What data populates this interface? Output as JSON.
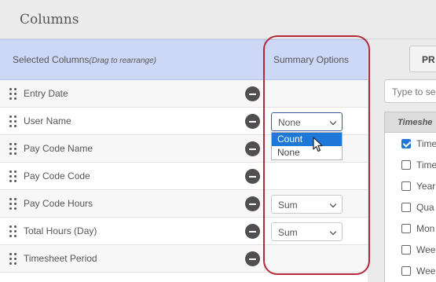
{
  "window": {
    "title": "Columns"
  },
  "header": {
    "selected_label": "Selected Columns",
    "selected_hint": "(Drag to rearrange)",
    "summary_label": "Summary Options"
  },
  "rows": [
    {
      "label": "Entry Date",
      "summary": null
    },
    {
      "label": "User Name",
      "summary": "None"
    },
    {
      "label": "Pay Code Name",
      "summary": null
    },
    {
      "label": "Pay Code Code",
      "summary": null
    },
    {
      "label": "Pay Code Hours",
      "summary": "Sum"
    },
    {
      "label": "Total Hours (Day)",
      "summary": "Sum"
    },
    {
      "label": "Timesheet Period",
      "summary": null
    }
  ],
  "dropdown": {
    "options": [
      "Count",
      "None"
    ],
    "highlighted": "Count"
  },
  "right": {
    "preview_label": "PR",
    "search_placeholder": "Type to se",
    "group_header": "Timeshe",
    "items": [
      {
        "label": "Time",
        "checked": true
      },
      {
        "label": "Time",
        "checked": false
      },
      {
        "label": "Year",
        "checked": false
      },
      {
        "label": "Qua",
        "checked": false
      },
      {
        "label": "Mon",
        "checked": false
      },
      {
        "label": "Wee",
        "checked": false
      },
      {
        "label": "Wee",
        "checked": false
      }
    ]
  },
  "colors": {
    "header_bg": "#cdd7f6",
    "highlight_ring": "#b22a3a",
    "option_highlight": "#1e78d7"
  }
}
